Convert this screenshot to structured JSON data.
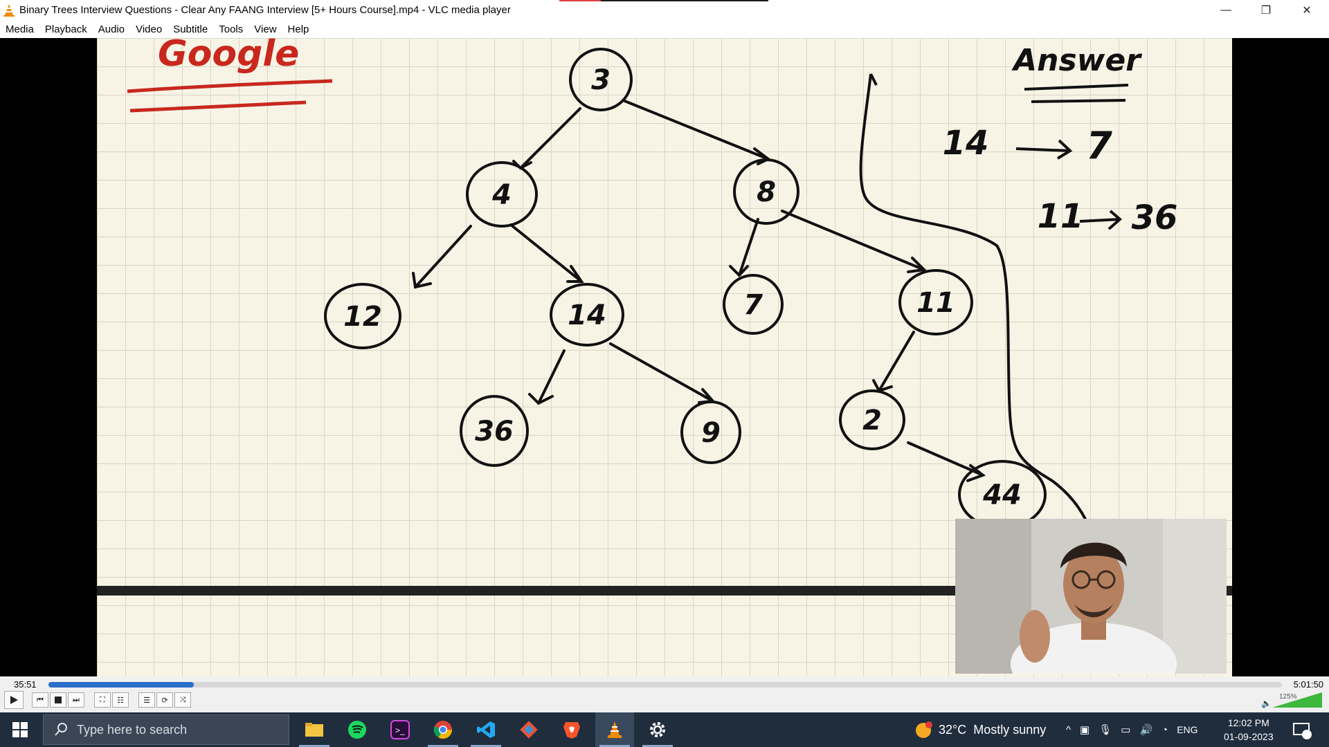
{
  "window": {
    "title": "Binary Trees Interview Questions - Clear Any FAANG Interview [5+ Hours Course].mp4 - VLC media player",
    "minimize_glyph": "—",
    "maximize_glyph": "❐",
    "close_glyph": "✕"
  },
  "menu": [
    "Media",
    "Playback",
    "Audio",
    "Video",
    "Subtitle",
    "Tools",
    "View",
    "Help"
  ],
  "video": {
    "company": "Google",
    "answer_title": "Answer",
    "answer_lines": [
      {
        "from": "14",
        "to": "7"
      },
      {
        "from": "11",
        "to": "36"
      }
    ],
    "tree_nodes": [
      "3",
      "4",
      "8",
      "12",
      "14",
      "7",
      "11",
      "36",
      "9",
      "2",
      "44"
    ],
    "ink_color": "#111111",
    "marker_red": "#c8281e"
  },
  "playback": {
    "elapsed": "35:51",
    "total": "5:01:50",
    "progress_fraction": 0.118,
    "volume_label": "125%",
    "volume_fraction": 1.0
  },
  "taskbar": {
    "search_placeholder": "Type here to search",
    "apps": [
      "file-explorer",
      "spotify",
      "terminal",
      "chrome",
      "vscode",
      "git",
      "brave",
      "vlc",
      "settings"
    ],
    "weather": "32°C  Mostly sunny",
    "language": "ENG",
    "clock_time": "12:02 PM",
    "clock_date": "01-09-2023",
    "notification_count": "7"
  },
  "colors": {
    "progress": "#2b6fc9",
    "taskbar": "#1f2d3d",
    "board": "#f7f4e6"
  }
}
